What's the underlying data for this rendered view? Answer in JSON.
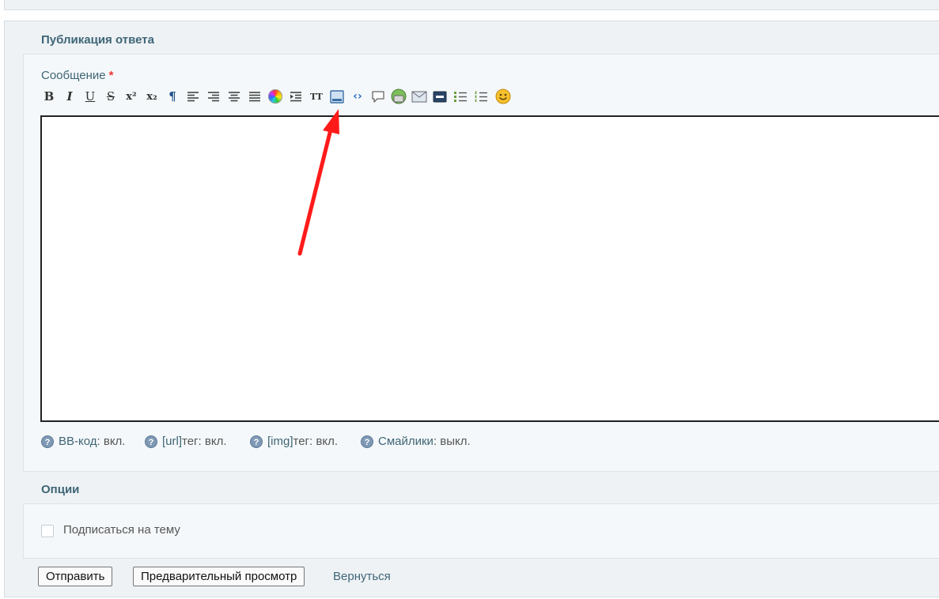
{
  "reply": {
    "title": "Публикация ответа",
    "message_label": "Сообщение",
    "required_mark": "*"
  },
  "toolbar": [
    {
      "name": "bold-button",
      "glyph": "B"
    },
    {
      "name": "italic-button",
      "glyph": "I"
    },
    {
      "name": "underline-button",
      "glyph": "U"
    },
    {
      "name": "strike-button",
      "glyph": "S"
    },
    {
      "name": "superscript-button",
      "glyph": "x²"
    },
    {
      "name": "subscript-button",
      "glyph": "x₂"
    },
    {
      "name": "paragraph-button",
      "glyph": "¶"
    },
    {
      "name": "align-left-button",
      "icon": "align-left-icon"
    },
    {
      "name": "align-right-button",
      "icon": "align-right-icon"
    },
    {
      "name": "align-center-button",
      "icon": "align-center-icon"
    },
    {
      "name": "justify-button",
      "icon": "justify-icon"
    },
    {
      "name": "color-button",
      "icon": "color-wheel-icon"
    },
    {
      "name": "indent-button",
      "icon": "indent-icon"
    },
    {
      "name": "font-size-button",
      "glyph": "TT"
    },
    {
      "name": "spoiler-button",
      "icon": "window-icon"
    },
    {
      "name": "code-button",
      "glyph": "‹›"
    },
    {
      "name": "quote-button",
      "icon": "speech-bubble-icon"
    },
    {
      "name": "image-button",
      "icon": "image-icon"
    },
    {
      "name": "email-button",
      "icon": "envelope-icon"
    },
    {
      "name": "video-button",
      "icon": "film-icon"
    },
    {
      "name": "bullet-list-button",
      "icon": "bullet-list-icon"
    },
    {
      "name": "numbered-list-button",
      "icon": "numbered-list-icon"
    },
    {
      "name": "smiley-button",
      "icon": "smiley-icon"
    }
  ],
  "bbcode_info": [
    {
      "link": "BB-код",
      "status": ": вкл."
    },
    {
      "link": "[url]",
      "status": " тег: вкл."
    },
    {
      "link": "[img]",
      "status": " тег: вкл."
    },
    {
      "link": "Смайлики",
      "status": ": выкл."
    }
  ],
  "options": {
    "title": "Опции",
    "subscribe_label": "Подписаться на тему",
    "subscribe_checked": false
  },
  "actions": {
    "submit_label": "Отправить",
    "preview_label": "Предварительный просмотр",
    "back_label": "Вернуться"
  },
  "colors": {
    "heading": "#3e6576",
    "panel_bg": "#eef2f5",
    "inner_bg": "#f5f8fa",
    "annotation_arrow": "#ff1a1a"
  }
}
